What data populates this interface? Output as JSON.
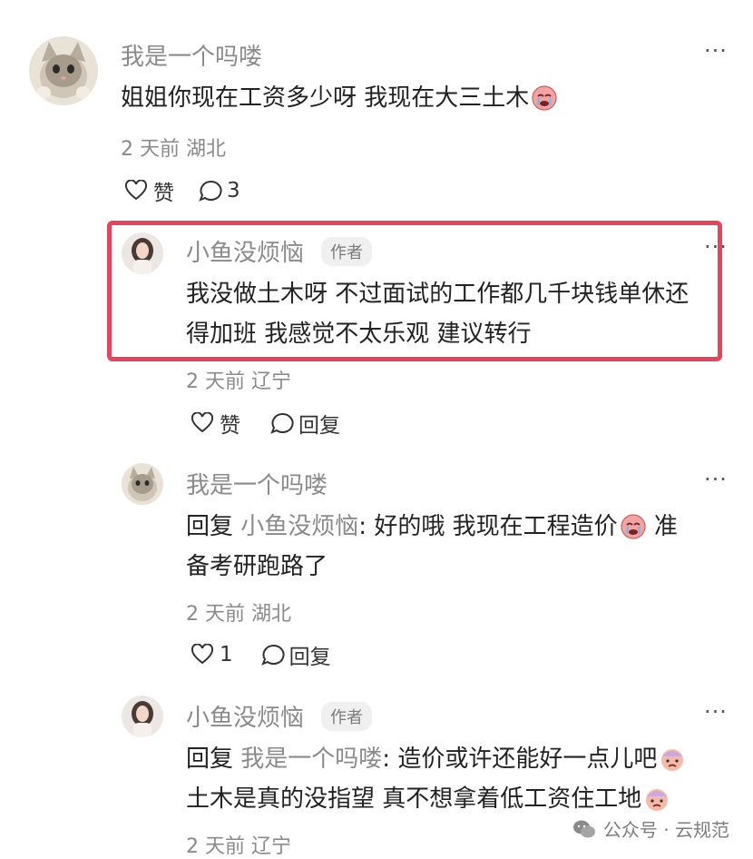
{
  "comments": [
    {
      "name": "我是一个吗喽",
      "content_text": "姐姐你现在工资多少呀 我现在大三土木",
      "content_emoji": "crying-face-emoji",
      "meta": "2 天前 湖北",
      "like_label": "赞",
      "reply_count": "3"
    },
    {
      "name": "小鱼没烦恼",
      "badge": "作者",
      "content_line1": "我没做土木呀 不过面试的工作都几千块钱单休还",
      "content_line2": "得加班 我感觉不太乐观 建议转行",
      "meta": "2 天前 辽宁",
      "like_label": "赞",
      "reply_label": "回复"
    },
    {
      "name": "我是一个吗喽",
      "reply_prefix": "回复",
      "mention": "小鱼没烦恼",
      "content_line1": ": 好的哦 我现在工程造价",
      "content_line1_tail": " 准",
      "content_line2": "备考研跑路了",
      "meta": "2 天前 湖北",
      "like_count": "1",
      "reply_label": "回复"
    },
    {
      "name": "小鱼没烦恼",
      "badge": "作者",
      "reply_prefix": "回复",
      "mention": "我是一个吗喽",
      "content_line1": ": 造价或许还能好一点儿吧",
      "content_line2": "土木是真的没指望 真不想拿着低工资住工地",
      "meta": "2 天前 辽宁"
    }
  ],
  "more_icon": "more-dots-icon",
  "watermark": "公众号 · 云规范",
  "colors": {
    "highlight": "#e8435c",
    "gray_text": "#8a8a8a"
  }
}
